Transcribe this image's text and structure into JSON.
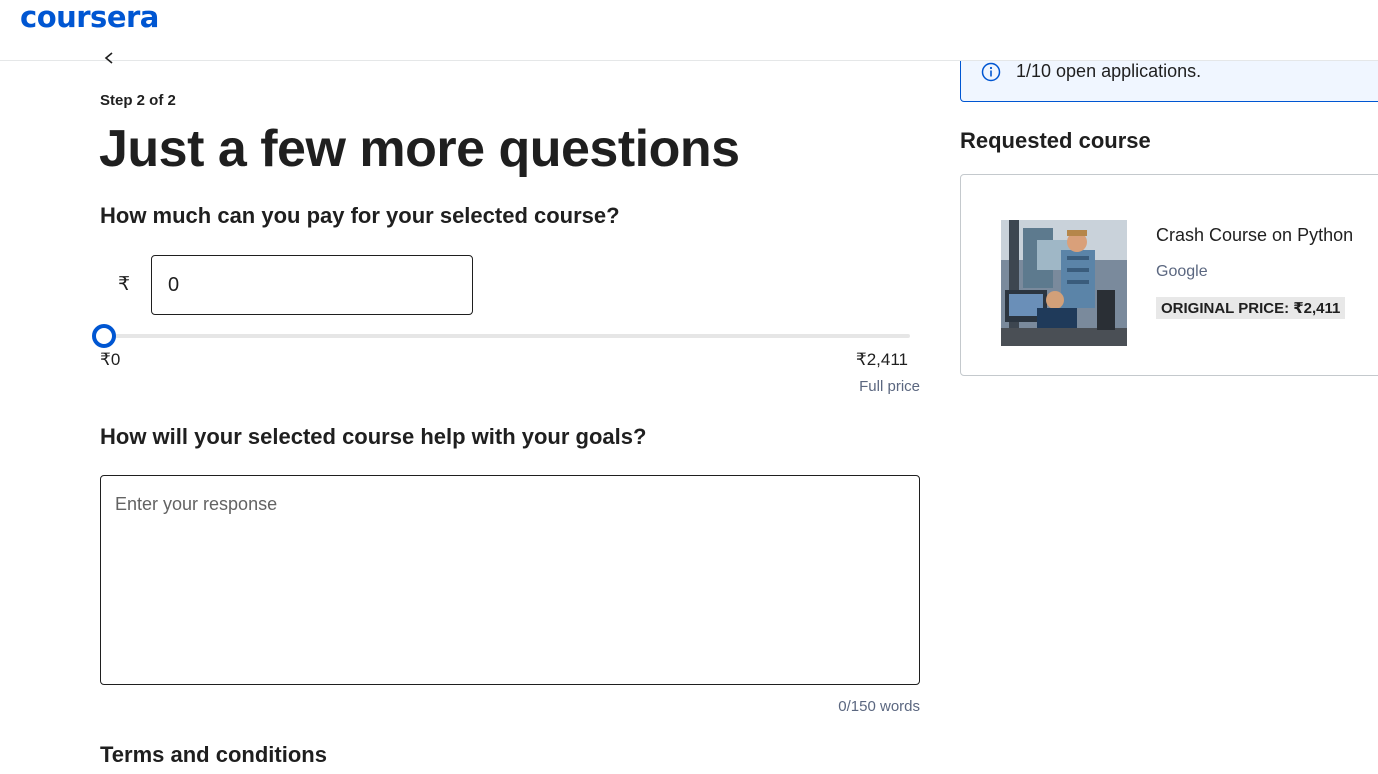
{
  "header": {
    "logo_text": "coursera"
  },
  "form": {
    "step_label": "Step 2 of 2",
    "title": "Just a few more questions",
    "payment": {
      "question": "How much can you pay for your selected course?",
      "currency_symbol": "₹",
      "amount_value": "0",
      "slider_value_fraction": 0,
      "range_min_label": "₹0",
      "range_max_label": "₹2,411",
      "range_max_caption": "Full price"
    },
    "goals": {
      "question": "How will your selected course help with your goals?",
      "placeholder": "Enter your response",
      "word_count": "0/150 words"
    },
    "terms_heading": "Terms and conditions"
  },
  "sidebar": {
    "info_banner_text": "1/10 open applications.",
    "requested_heading": "Requested course",
    "course": {
      "title": "Crash Course on Python",
      "partner": "Google",
      "price_badge": "ORIGINAL PRICE: ₹2,411"
    }
  },
  "colors": {
    "brand": "#0056d2",
    "text": "#1f1f1f",
    "muted": "#5b6780",
    "banner_bg": "#f0f6ff"
  },
  "icons": {
    "back": "chevron-left-icon",
    "info": "info-icon",
    "slider": "slider-thumb"
  }
}
